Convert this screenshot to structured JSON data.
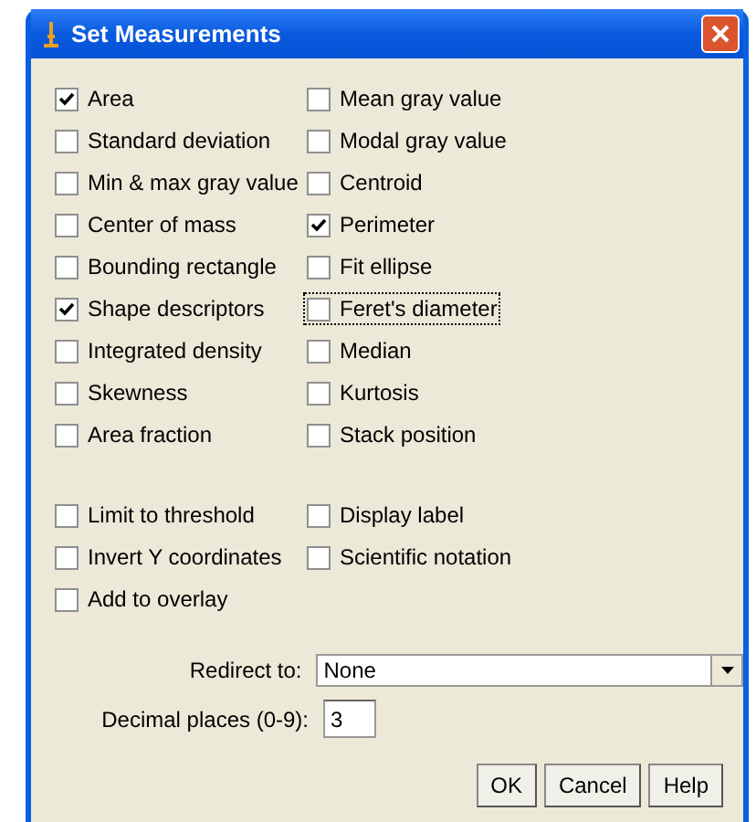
{
  "window": {
    "title": "Set Measurements"
  },
  "measurements": [
    {
      "label": "Area",
      "checked": true,
      "focused": false
    },
    {
      "label": "Mean gray value",
      "checked": false,
      "focused": false
    },
    {
      "label": "Standard deviation",
      "checked": false,
      "focused": false
    },
    {
      "label": "Modal gray value",
      "checked": false,
      "focused": false
    },
    {
      "label": "Min & max gray value",
      "checked": false,
      "focused": false
    },
    {
      "label": "Centroid",
      "checked": false,
      "focused": false
    },
    {
      "label": "Center of mass",
      "checked": false,
      "focused": false
    },
    {
      "label": "Perimeter",
      "checked": true,
      "focused": false
    },
    {
      "label": "Bounding rectangle",
      "checked": false,
      "focused": false
    },
    {
      "label": "Fit ellipse",
      "checked": false,
      "focused": false
    },
    {
      "label": "Shape descriptors",
      "checked": true,
      "focused": false
    },
    {
      "label": "Feret's diameter",
      "checked": false,
      "focused": true
    },
    {
      "label": "Integrated density",
      "checked": false,
      "focused": false
    },
    {
      "label": "Median",
      "checked": false,
      "focused": false
    },
    {
      "label": "Skewness",
      "checked": false,
      "focused": false
    },
    {
      "label": "Kurtosis",
      "checked": false,
      "focused": false
    },
    {
      "label": "Area fraction",
      "checked": false,
      "focused": false
    },
    {
      "label": "Stack position",
      "checked": false,
      "focused": false
    }
  ],
  "options": [
    {
      "label": "Limit to threshold",
      "checked": false,
      "focused": false
    },
    {
      "label": "Display label",
      "checked": false,
      "focused": false
    },
    {
      "label": "Invert Y coordinates",
      "checked": false,
      "focused": false
    },
    {
      "label": "Scientific notation",
      "checked": false,
      "focused": false
    },
    {
      "label": "Add to overlay",
      "checked": false,
      "focused": false
    }
  ],
  "redirect": {
    "label": "Redirect to:",
    "value": "None"
  },
  "decimal_places": {
    "label": "Decimal places (0-9):",
    "value": "3"
  },
  "buttons": [
    "OK",
    "Cancel",
    "Help"
  ]
}
